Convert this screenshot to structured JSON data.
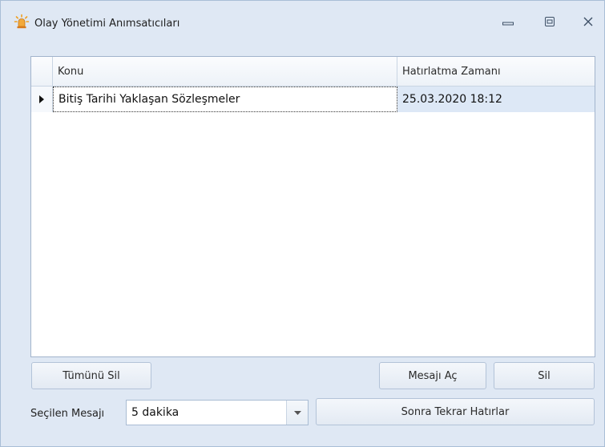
{
  "window": {
    "title": "Olay Yönetimi Anımsatıcıları",
    "icon": "bell-alarm-icon",
    "controls": [
      "minimize-icon",
      "maximize-icon",
      "close-icon"
    ]
  },
  "grid": {
    "columns": [
      "Konu",
      "Hatırlatma Zamanı"
    ],
    "rows": [
      {
        "konu": "Bitiş Tarihi Yaklaşan Sözleşmeler",
        "zaman": "25.03.2020 18:12",
        "selected": true
      }
    ]
  },
  "buttons": {
    "delete_all": "Tümünü Sil",
    "open_message": "Mesajı Aç",
    "delete": "Sil",
    "snooze": "Sonra Tekrar Hatırlar"
  },
  "snooze": {
    "label": "Seçilen Mesajı",
    "selected": "5 dakika"
  },
  "colors": {
    "window_bg": "#dfe8f4",
    "selected_cell": "#dde8f6",
    "icon_accent": "#f0a020"
  }
}
